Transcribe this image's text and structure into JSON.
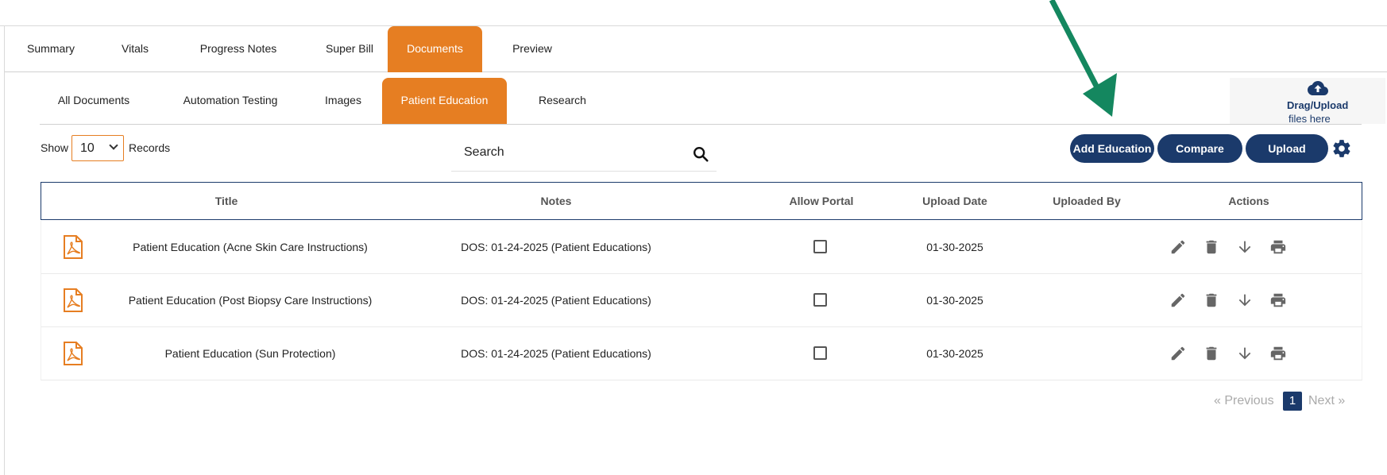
{
  "main_tabs": [
    {
      "label": "Summary",
      "active": false
    },
    {
      "label": "Vitals",
      "active": false
    },
    {
      "label": "Progress Notes",
      "active": false
    },
    {
      "label": "Super Bill",
      "active": false
    },
    {
      "label": "Documents",
      "active": true
    },
    {
      "label": "Preview",
      "active": false
    }
  ],
  "sub_tabs": [
    {
      "label": "All Documents",
      "active": false
    },
    {
      "label": "Automation Testing",
      "active": false
    },
    {
      "label": "Images",
      "active": false
    },
    {
      "label": "Patient Education",
      "active": true
    },
    {
      "label": "Research",
      "active": false
    }
  ],
  "drag_upload": {
    "title": "Drag/Upload",
    "subtitle": "files here",
    "icon": "cloud-upload-icon"
  },
  "records": {
    "show_label": "Show",
    "value": "10",
    "suffix_label": "Records"
  },
  "search": {
    "placeholder": "Search",
    "icon": "search-icon"
  },
  "buttons": {
    "add_education": "Add Education",
    "compare": "Compare",
    "upload": "Upload"
  },
  "table": {
    "columns": [
      "Title",
      "Notes",
      "Allow Portal",
      "Upload Date",
      "Uploaded By",
      "Actions"
    ],
    "rows": [
      {
        "title": "Patient Education (Acne Skin Care Instructions)",
        "notes": "DOS: 01-24-2025 (Patient Educations)",
        "allow_portal": false,
        "upload_date": "01-30-2025",
        "uploaded_by": ""
      },
      {
        "title": "Patient Education (Post Biopsy Care Instructions)",
        "notes": "DOS: 01-24-2025 (Patient Educations)",
        "allow_portal": false,
        "upload_date": "01-30-2025",
        "uploaded_by": ""
      },
      {
        "title": "Patient Education (Sun Protection)",
        "notes": "DOS: 01-24-2025 (Patient Educations)",
        "allow_portal": false,
        "upload_date": "01-30-2025",
        "uploaded_by": ""
      }
    ],
    "row_icons": [
      "pdf-icon",
      "edit-icon",
      "delete-icon",
      "download-icon",
      "print-icon"
    ]
  },
  "pagination": {
    "prev": "« Previous",
    "current": "1",
    "next": "Next »"
  },
  "colors": {
    "accent": "#e67e22",
    "primary": "#1b3a6b",
    "annotation_arrow": "#14875f"
  }
}
